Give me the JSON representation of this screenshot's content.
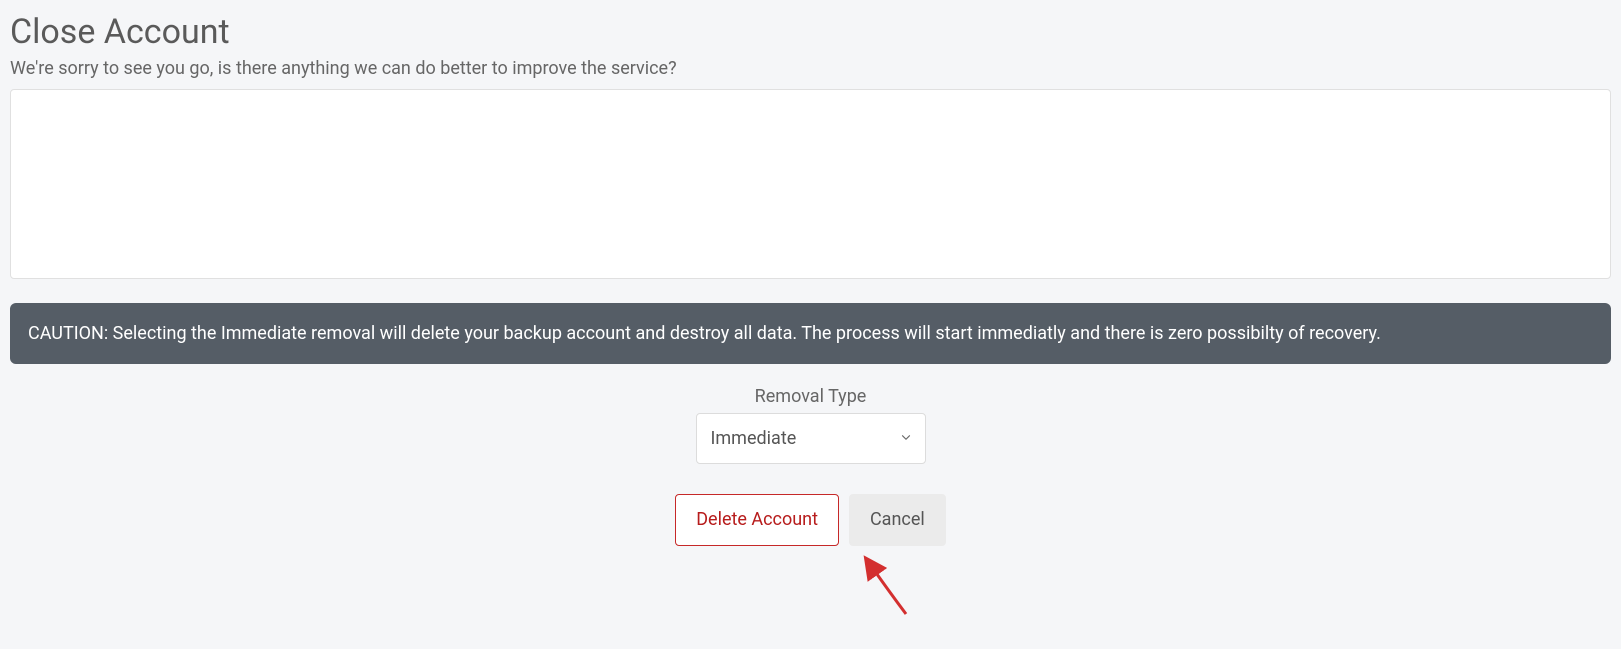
{
  "header": {
    "title": "Close Account",
    "subtext": "We're sorry to see you go, is there anything we can do better to improve the service?"
  },
  "feedback": {
    "value": ""
  },
  "caution": {
    "text": "CAUTION: Selecting the Immediate removal will delete your backup account and destroy all data. The process will start immediatly and there is zero possibilty of recovery."
  },
  "removal": {
    "label": "Removal Type",
    "selected": "Immediate"
  },
  "buttons": {
    "delete": "Delete Account",
    "cancel": "Cancel"
  },
  "colors": {
    "danger": "#b71c1c",
    "banner_bg": "#555d66",
    "page_bg": "#f5f6f8",
    "arrow": "#d32f2f"
  }
}
